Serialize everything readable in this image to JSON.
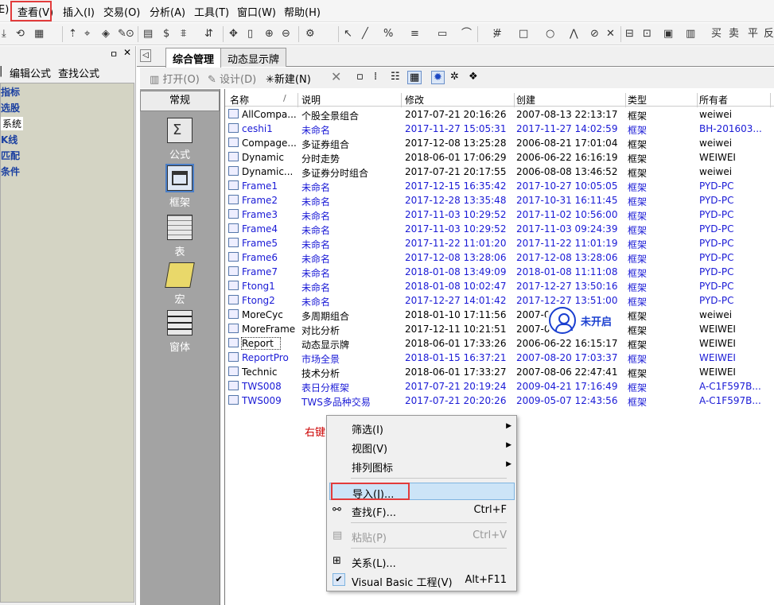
{
  "menubar": {
    "items": [
      "E)",
      "查看(V)",
      "插入(I)",
      "交易(O)",
      "分析(A)",
      "工具(T)",
      "窗口(W)",
      "帮助(H)"
    ]
  },
  "toolbar": {
    "glyphs": [
      "⤓",
      "⟲",
      "▦",
      "⇡",
      "⌖",
      "◈",
      "✎",
      "⊙",
      "▤",
      "$",
      "⩨",
      "⇵",
      "✥",
      "▯",
      "⊕",
      "⊖",
      "⚙",
      "↖",
      "╱",
      "%",
      "≡",
      "▭",
      "⌒",
      "⋮",
      "#",
      "□",
      "○",
      "⋀",
      "⊘",
      "✕",
      "⊟",
      "⊡",
      "▣",
      "▥",
      "买",
      "卖",
      "平",
      "反"
    ]
  },
  "leftpanel": {
    "pin": "ㅁ",
    "close": "✕",
    "tab_edit": "编辑公式",
    "tab_find": "查找公式",
    "tree": [
      "指标",
      "选股",
      "系统",
      "K线",
      "匹配",
      "条件"
    ]
  },
  "tabs": {
    "nav": "◁",
    "active": "综合管理",
    "second": "动态显示牌"
  },
  "actions": {
    "open": "打开(O)",
    "design": "设计(D)",
    "new": "新建(N)",
    "delete": "✕"
  },
  "categories": {
    "header": "常规",
    "items": [
      "公式",
      "框架",
      "表",
      "宏",
      "窗体"
    ]
  },
  "list": {
    "columns": [
      "名称",
      "说明",
      "修改",
      "创建",
      "类型",
      "所有者"
    ],
    "rows": [
      {
        "name": "AllCompa...",
        "desc": "个股全景组合",
        "modified": "2017-07-21 20:16:26",
        "created": "2007-08-13 22:13:17",
        "type": "框架",
        "owner": "weiwei",
        "blue": false
      },
      {
        "name": "ceshi1",
        "desc": "未命名",
        "modified": "2017-11-27 15:05:31",
        "created": "2017-11-27 14:02:59",
        "type": "框架",
        "owner": "BH-201603...",
        "blue": true
      },
      {
        "name": "Compage...",
        "desc": "多证券组合",
        "modified": "2017-12-08 13:25:28",
        "created": "2006-08-21 17:01:04",
        "type": "框架",
        "owner": "weiwei",
        "blue": false
      },
      {
        "name": "Dynamic",
        "desc": "分时走势",
        "modified": "2018-06-01 17:06:29",
        "created": "2006-06-22 16:16:19",
        "type": "框架",
        "owner": "WEIWEI",
        "blue": false
      },
      {
        "name": "Dynamic...",
        "desc": "多证券分时组合",
        "modified": "2017-07-21 20:17:55",
        "created": "2006-08-08 13:46:52",
        "type": "框架",
        "owner": "weiwei",
        "blue": false
      },
      {
        "name": "Frame1",
        "desc": "未命名",
        "modified": "2017-12-15 16:35:42",
        "created": "2017-10-27 10:05:05",
        "type": "框架",
        "owner": "PYD-PC",
        "blue": true
      },
      {
        "name": "Frame2",
        "desc": "未命名",
        "modified": "2017-12-28 13:35:48",
        "created": "2017-10-31 16:11:45",
        "type": "框架",
        "owner": "PYD-PC",
        "blue": true
      },
      {
        "name": "Frame3",
        "desc": "未命名",
        "modified": "2017-11-03 10:29:52",
        "created": "2017-11-02 10:56:00",
        "type": "框架",
        "owner": "PYD-PC",
        "blue": true
      },
      {
        "name": "Frame4",
        "desc": "未命名",
        "modified": "2017-11-03 10:29:52",
        "created": "2017-11-03 09:24:39",
        "type": "框架",
        "owner": "PYD-PC",
        "blue": true
      },
      {
        "name": "Frame5",
        "desc": "未命名",
        "modified": "2017-11-22 11:01:20",
        "created": "2017-11-22 11:01:19",
        "type": "框架",
        "owner": "PYD-PC",
        "blue": true
      },
      {
        "name": "Frame6",
        "desc": "未命名",
        "modified": "2017-12-08 13:28:06",
        "created": "2017-12-08 13:28:06",
        "type": "框架",
        "owner": "PYD-PC",
        "blue": true
      },
      {
        "name": "Frame7",
        "desc": "未命名",
        "modified": "2018-01-08 13:49:09",
        "created": "2018-01-08 11:11:08",
        "type": "框架",
        "owner": "PYD-PC",
        "blue": true
      },
      {
        "name": "Ftong1",
        "desc": "未命名",
        "modified": "2018-01-08 10:02:47",
        "created": "2017-12-27 13:50:16",
        "type": "框架",
        "owner": "PYD-PC",
        "blue": true
      },
      {
        "name": "Ftong2",
        "desc": "未命名",
        "modified": "2017-12-27 14:01:42",
        "created": "2017-12-27 13:51:00",
        "type": "框架",
        "owner": "PYD-PC",
        "blue": true
      },
      {
        "name": "MoreCyc",
        "desc": "多周期组合",
        "modified": "2018-01-10 17:11:56",
        "created": "2007-0",
        "type": "框架",
        "owner": "weiwei",
        "blue": false
      },
      {
        "name": "MoreFrame",
        "desc": "对比分析",
        "modified": "2017-12-11 10:21:51",
        "created": "2007-0",
        "type": "框架",
        "owner": "WEIWEI",
        "blue": false
      },
      {
        "name": "Report",
        "desc": "动态显示牌",
        "modified": "2018-06-01 17:33:26",
        "created": "2006-06-22 16:15:17",
        "type": "框架",
        "owner": "WEIWEI",
        "blue": false
      },
      {
        "name": "ReportPro",
        "desc": "市场全景",
        "modified": "2018-01-15 16:37:21",
        "created": "2007-08-20 17:03:37",
        "type": "框架",
        "owner": "WEIWEI",
        "blue": true
      },
      {
        "name": "Technic",
        "desc": "技术分析",
        "modified": "2018-06-01 17:33:27",
        "created": "2007-08-06 22:47:41",
        "type": "框架",
        "owner": "WEIWEI",
        "blue": false
      },
      {
        "name": "TWS008",
        "desc": "表日分框架",
        "modified": "2017-07-21 20:19:24",
        "created": "2009-04-21 17:16:49",
        "type": "框架",
        "owner": "A-C1F597B...",
        "blue": true
      },
      {
        "name": "TWS009",
        "desc": "TWS多品种交易",
        "modified": "2017-07-21 20:20:26",
        "created": "2009-05-07 12:43:56",
        "type": "框架",
        "owner": "A-C1F597B...",
        "blue": true
      }
    ]
  },
  "overlay": {
    "text": "未开启"
  },
  "annotation": {
    "right_click": "右键"
  },
  "context_menu": {
    "filter": "筛选(I)",
    "view": "视图(V)",
    "sort_icons": "排列图标",
    "import": "导入(J)...",
    "find": "查找(F)...",
    "find_shortcut": "Ctrl+F",
    "paste": "粘贴(P)",
    "paste_shortcut": "Ctrl+V",
    "relation": "关系(L)...",
    "vb": "Visual Basic 工程(V)",
    "vb_shortcut": "Alt+F11"
  },
  "colors": {
    "highlight_box": "#e23b3b",
    "link_blue": "#1a1ad6"
  }
}
